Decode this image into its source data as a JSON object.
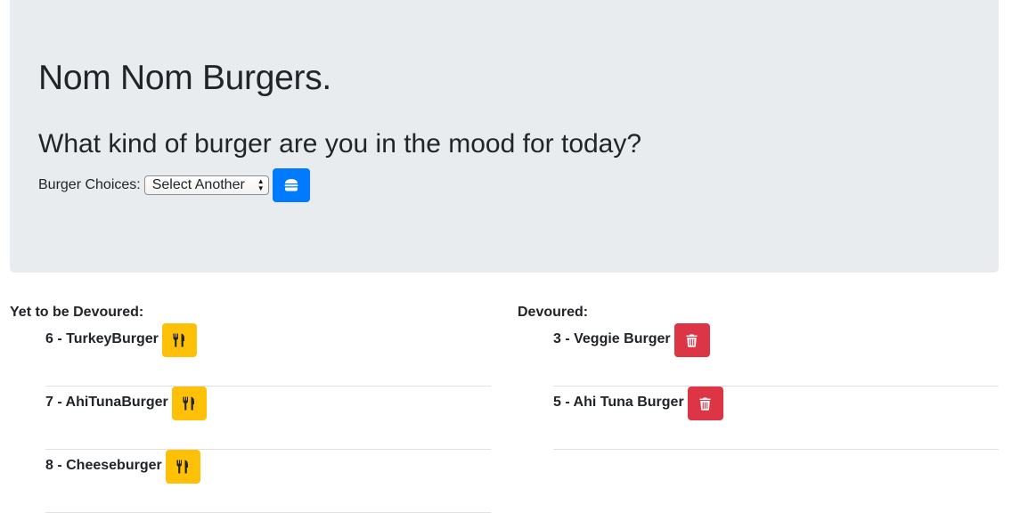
{
  "header": {
    "title": "Nom Nom Burgers.",
    "subtitle": "What kind of burger are you in the mood for today?",
    "choice_label": "Burger Choices:",
    "select_value": "Select Another",
    "submit_icon": "burger-icon"
  },
  "yet_to_devour": {
    "heading": "Yet to be Devoured:",
    "items": [
      {
        "label": "6 - TurkeyBurger",
        "action_icon": "utensils-icon"
      },
      {
        "label": "7 - AhiTunaBurger",
        "action_icon": "utensils-icon"
      },
      {
        "label": "8 - Cheeseburger",
        "action_icon": "utensils-icon"
      }
    ]
  },
  "devoured": {
    "heading": "Devoured:",
    "items": [
      {
        "label": "3 - Veggie Burger",
        "action_icon": "trash-icon"
      },
      {
        "label": "5 - Ahi Tuna Burger",
        "action_icon": "trash-icon"
      }
    ]
  },
  "colors": {
    "jumbotron": "#e9ecef",
    "primary": "#007bff",
    "warning": "#ffc107",
    "danger": "#dc3545"
  }
}
